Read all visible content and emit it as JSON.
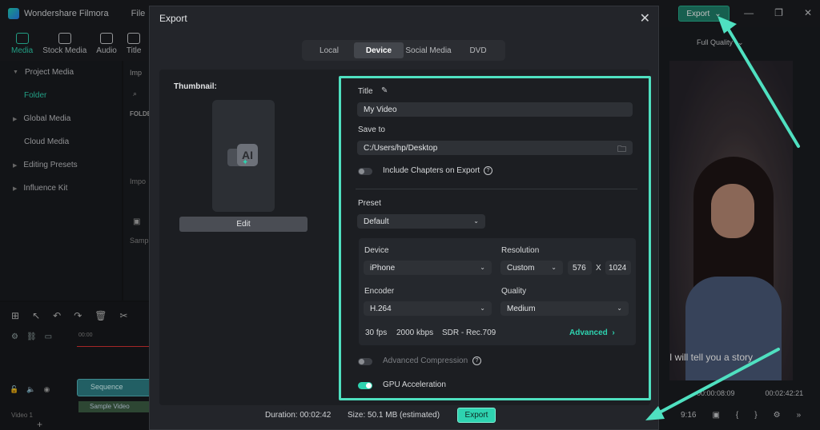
{
  "app": {
    "name": "Wondershare Filmora",
    "menu_file": "File",
    "top_export": "Export",
    "toolbar": [
      "Media",
      "Stock Media",
      "Audio",
      "Title"
    ],
    "sidebar": [
      {
        "label": "Project Media",
        "type": "parent"
      },
      {
        "label": "Folder",
        "type": "selected"
      },
      {
        "label": "Global Media",
        "type": "parent"
      },
      {
        "label": "Cloud Media",
        "type": "sub"
      },
      {
        "label": "Editing Presets",
        "type": "parent"
      },
      {
        "label": "Influence Kit",
        "type": "parent"
      }
    ],
    "panel_import": "Imp",
    "panel_folder": "FOLDE",
    "panel_import2": "Impo",
    "panel_sample": "Samp",
    "quality": "Full Quality",
    "subtitle": "I will tell you a story",
    "time_current": "00:00:08:09",
    "time_total": "00:02:42:21",
    "aspect": "9:16",
    "timeline_time": "00:00",
    "clip_sequence": "Sequence",
    "clip_video": "Sample Video",
    "track_label": "Video 1"
  },
  "dialog": {
    "title": "Export",
    "tabs": [
      {
        "label": "Local",
        "active": false
      },
      {
        "label": "Device",
        "active": true
      },
      {
        "label": "Social Media",
        "active": false
      },
      {
        "label": "DVD",
        "active": false
      }
    ],
    "thumbnail_label": "Thumbnail:",
    "thumbnail_icon_text": "AI",
    "edit_label": "Edit",
    "title_label": "Title",
    "title_value": "My Video",
    "save_to_label": "Save to",
    "save_to_value": "C:/Users/hp/Desktop",
    "include_chapters": "Include Chapters on Export",
    "preset_label": "Preset",
    "preset_value": "Default",
    "device_label": "Device",
    "device_value": "iPhone",
    "resolution_label": "Resolution",
    "resolution_value": "Custom",
    "width_value": "576",
    "x_sep": "X",
    "height_value": "1024",
    "encoder_label": "Encoder",
    "encoder_value": "H.264",
    "quality_label": "Quality",
    "quality_value": "Medium",
    "fps": "30 fps",
    "bitrate": "2000 kbps",
    "color_space": "SDR - Rec.709",
    "advanced": "Advanced",
    "advanced_compression": "Advanced Compression",
    "gpu_acceleration": "GPU Acceleration",
    "duration": "Duration: 00:02:42",
    "size": "Size:  50.1 MB (estimated)",
    "export_button": "Export"
  },
  "colors": {
    "accent": "#2ed3b0",
    "highlight_border": "#4fe0c0"
  }
}
